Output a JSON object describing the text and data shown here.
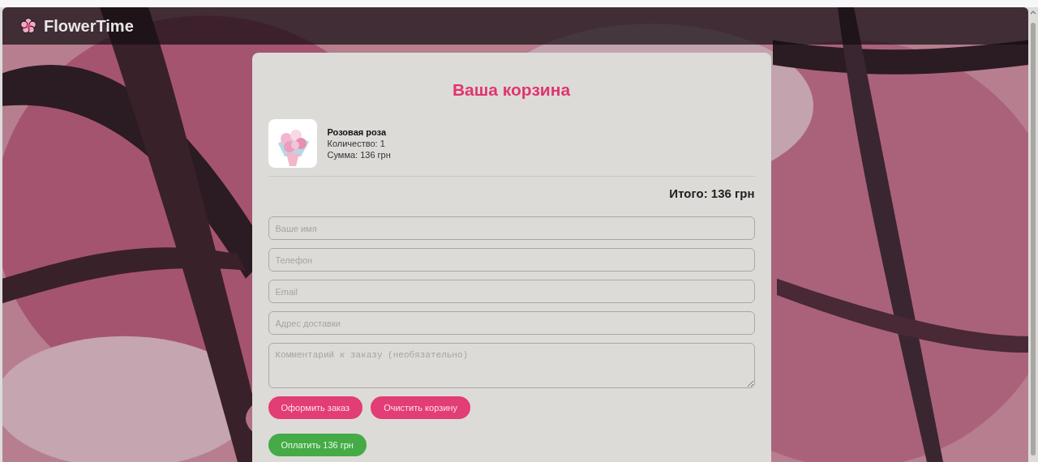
{
  "header": {
    "logo_text": "FlowerTime"
  },
  "cart": {
    "title": "Ваша корзина",
    "items": [
      {
        "name": "Розовая роза",
        "quantity": "Количество: 1",
        "sum": "Сумма: 136 грн"
      }
    ],
    "total": "Итого: 136 грн"
  },
  "form": {
    "fields": [
      {
        "kind": "input",
        "placeholder": "Ваше имя"
      },
      {
        "kind": "input",
        "placeholder": "Телефон"
      },
      {
        "kind": "input",
        "placeholder": "Email"
      },
      {
        "kind": "input",
        "placeholder": "Адрес доставки"
      },
      {
        "kind": "textarea",
        "placeholder": "Комментарий к заказу (необязательно)"
      }
    ],
    "buttons": [
      {
        "kind": "accent",
        "label": "Оформить заказ"
      },
      {
        "kind": "accent",
        "label": "Очистить корзину"
      }
    ],
    "pay_button": {
      "kind": "pay",
      "label": "Оплатить 136 грн"
    }
  }
}
